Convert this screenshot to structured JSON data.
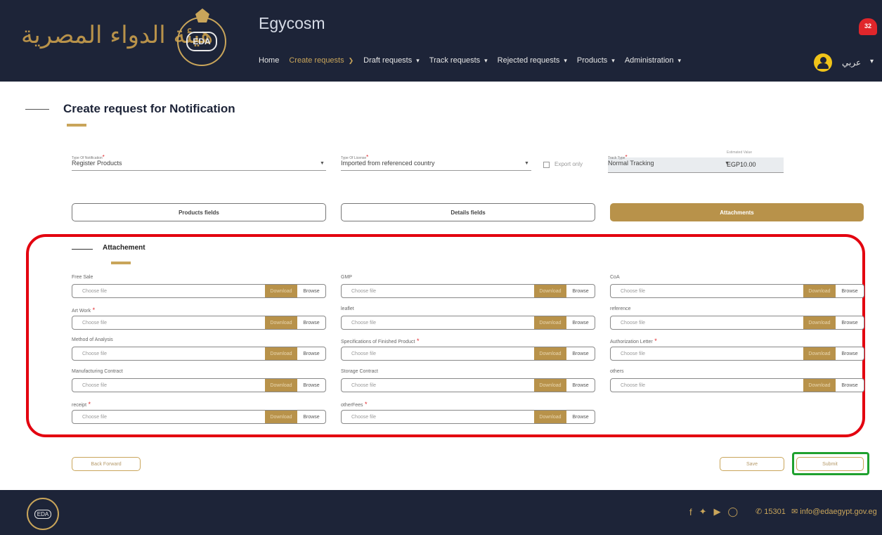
{
  "header": {
    "logo_text": "هيئة الدواء المصرية",
    "seal_text": "EDA",
    "app_title": "Egycosm",
    "nav": [
      {
        "label": "Home",
        "has_dropdown": false,
        "active": false
      },
      {
        "label": "Create requests",
        "has_dropdown": true,
        "active": true
      },
      {
        "label": "Draft requests",
        "has_dropdown": true,
        "active": false
      },
      {
        "label": "Track requests",
        "has_dropdown": true,
        "active": false
      },
      {
        "label": "Rejected requests",
        "has_dropdown": true,
        "active": false
      },
      {
        "label": "Products",
        "has_dropdown": true,
        "active": false
      },
      {
        "label": "Administration",
        "has_dropdown": true,
        "active": false
      }
    ],
    "language": "عربي",
    "notification_count": "32"
  },
  "page": {
    "title": "Create request for Notification"
  },
  "form": {
    "type_of_notification": {
      "label": "Type Of Notification",
      "value": "Register Products"
    },
    "type_of_license": {
      "label": "Type Of License",
      "value": "Imported from referenced country"
    },
    "export_only": {
      "label": "Export only",
      "checked": false
    },
    "track_type": {
      "label": "Track Type",
      "value": "Normal Tracking"
    },
    "estimated_value": {
      "label": "Estimated Value",
      "value": "EGP10.00"
    }
  },
  "tabs": [
    {
      "label": "Products fields",
      "active": false
    },
    {
      "label": "Details fields",
      "active": false
    },
    {
      "label": "Attachments",
      "active": true
    }
  ],
  "attachments": {
    "title": "Attachement",
    "choose_placeholder": "Choose file",
    "download_label": "Download",
    "browse_label": "Browse",
    "fields": [
      {
        "label": "Free Sale",
        "required": false
      },
      {
        "label": "GMP",
        "required": false
      },
      {
        "label": "CoA",
        "required": false
      },
      {
        "label": "Art Work",
        "required": true
      },
      {
        "label": "leaflet",
        "required": false
      },
      {
        "label": "reference",
        "required": false
      },
      {
        "label": "Method of Analysis",
        "required": false
      },
      {
        "label": "Specifications of Finished Product",
        "required": true
      },
      {
        "label": "Authorization Letter",
        "required": true
      },
      {
        "label": "Manufacturing Contract",
        "required": false
      },
      {
        "label": "Storage Contract",
        "required": false
      },
      {
        "label": "others",
        "required": false
      },
      {
        "label": "receipt",
        "required": true
      },
      {
        "label": "otherFees",
        "required": true
      }
    ]
  },
  "actions": {
    "back_label": "Back Forward",
    "save_label": "Save",
    "submit_label": "Submit"
  },
  "footer": {
    "seal_text": "EDA",
    "phone": "15301",
    "email": "info@edaegypt.gov.eg"
  },
  "colors": {
    "header_bg": "#1d2438",
    "accent_gold": "#b8924a",
    "highlight_red": "#e3000f",
    "highlight_green": "#1fa12e"
  }
}
